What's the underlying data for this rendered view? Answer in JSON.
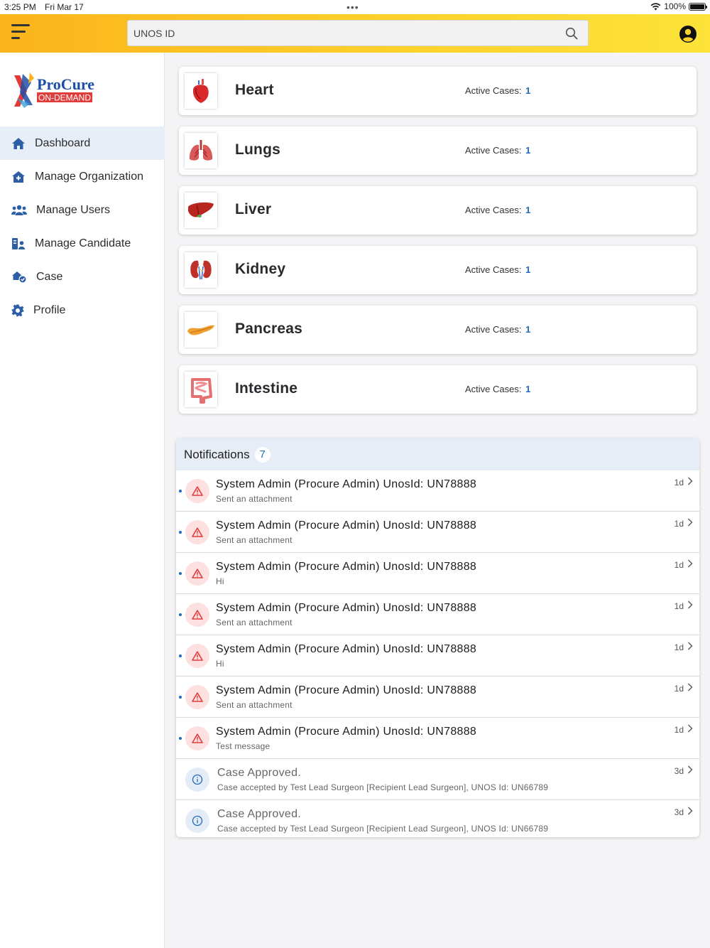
{
  "status_bar": {
    "time": "3:25 PM",
    "date": "Fri Mar 17",
    "battery": "100%"
  },
  "header": {
    "search_placeholder": "UNOS ID"
  },
  "logo": {
    "brand_top": "ProCure",
    "brand_bottom": "ON-DEMAND"
  },
  "sidebar": {
    "items": [
      {
        "label": "Dashboard",
        "icon": "home-icon",
        "active": true
      },
      {
        "label": "Manage Organization",
        "icon": "organization-icon",
        "active": false
      },
      {
        "label": "Manage Users",
        "icon": "users-icon",
        "active": false
      },
      {
        "label": "Manage Candidate",
        "icon": "candidate-icon",
        "active": false
      },
      {
        "label": "Case",
        "icon": "case-icon",
        "active": false
      },
      {
        "label": "Profile",
        "icon": "gear-icon",
        "active": false
      }
    ]
  },
  "organs": [
    {
      "name": "Heart",
      "active_label": "Active Cases:",
      "count": "1",
      "icon": "heart-organ-icon"
    },
    {
      "name": "Lungs",
      "active_label": "Active Cases:",
      "count": "1",
      "icon": "lungs-organ-icon"
    },
    {
      "name": "Liver",
      "active_label": "Active Cases:",
      "count": "1",
      "icon": "liver-organ-icon"
    },
    {
      "name": "Kidney",
      "active_label": "Active Cases:",
      "count": "1",
      "icon": "kidney-organ-icon"
    },
    {
      "name": "Pancreas",
      "active_label": "Active Cases:",
      "count": "1",
      "icon": "pancreas-organ-icon"
    },
    {
      "name": "Intestine",
      "active_label": "Active Cases:",
      "count": "1",
      "icon": "intestine-organ-icon"
    }
  ],
  "notifications": {
    "title": "Notifications",
    "count": "7",
    "items": [
      {
        "title": "System Admin (Procure Admin) UnosId: UN78888",
        "subtitle": "Sent an attachment",
        "time": "1d",
        "type": "warning",
        "unread": true
      },
      {
        "title": "System Admin (Procure Admin) UnosId: UN78888",
        "subtitle": "Sent an attachment",
        "time": "1d",
        "type": "warning",
        "unread": true
      },
      {
        "title": "System Admin (Procure Admin) UnosId: UN78888",
        "subtitle": "Hi",
        "time": "1d",
        "type": "warning",
        "unread": true
      },
      {
        "title": "System Admin (Procure Admin) UnosId: UN78888",
        "subtitle": "Sent an attachment",
        "time": "1d",
        "type": "warning",
        "unread": true
      },
      {
        "title": "System Admin (Procure Admin) UnosId: UN78888",
        "subtitle": "Hi",
        "time": "1d",
        "type": "warning",
        "unread": true
      },
      {
        "title": "System Admin (Procure Admin) UnosId: UN78888",
        "subtitle": "Sent an attachment",
        "time": "1d",
        "type": "warning",
        "unread": true
      },
      {
        "title": "System Admin (Procure Admin) UnosId: UN78888",
        "subtitle": "Test message",
        "time": "1d",
        "type": "warning",
        "unread": true
      },
      {
        "title": "Case Approved.",
        "subtitle": "Case accepted by Test Lead Surgeon [Recipient Lead Surgeon], UNOS Id: UN66789",
        "time": "3d",
        "type": "info",
        "unread": false
      },
      {
        "title": "Case Approved.",
        "subtitle": "Case accepted by Test Lead Surgeon [Recipient Lead Surgeon], UNOS Id: UN66789",
        "time": "3d",
        "type": "info",
        "unread": false
      }
    ]
  },
  "colors": {
    "accent": "#1e6bb8",
    "header_start": "#fbb41c",
    "header_end": "#fde33a",
    "warning": "#e03c3c"
  }
}
